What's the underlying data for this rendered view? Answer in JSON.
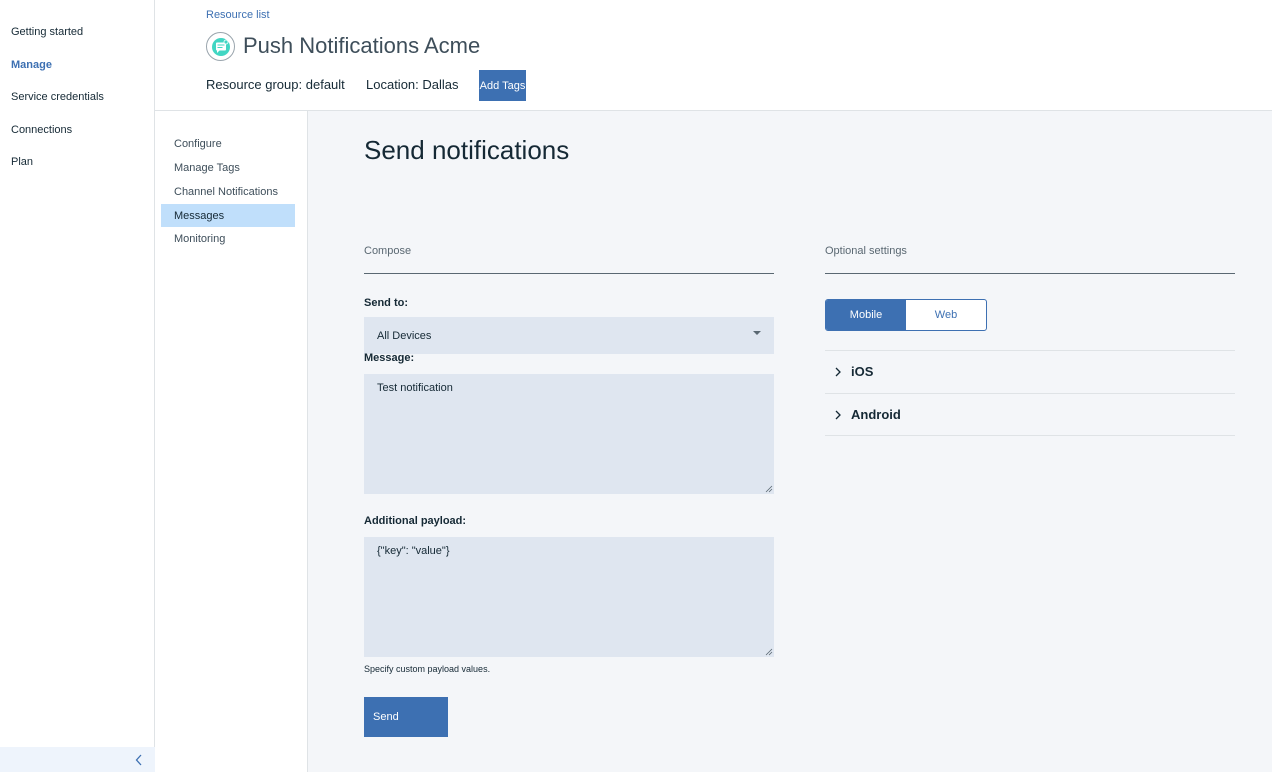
{
  "leftnav": {
    "items": [
      {
        "label": "Getting started"
      },
      {
        "label": "Manage"
      },
      {
        "label": "Service credentials"
      },
      {
        "label": "Connections"
      },
      {
        "label": "Plan"
      }
    ],
    "active": "Manage"
  },
  "header": {
    "breadcrumb": "Resource list",
    "title": "Push Notifications Acme",
    "resource_group_label": "Resource group:",
    "resource_group_value": "default",
    "location_label": "Location:",
    "location_value": "Dallas",
    "add_tags": "Add Tags"
  },
  "subnav": {
    "items": [
      {
        "label": "Configure"
      },
      {
        "label": "Manage Tags"
      },
      {
        "label": "Channel Notifications"
      },
      {
        "label": "Messages"
      },
      {
        "label": "Monitoring"
      }
    ],
    "active": "Messages"
  },
  "main": {
    "heading": "Send notifications",
    "compose_label": "Compose",
    "optional_label": "Optional settings",
    "send_to_label": "Send to:",
    "send_to_value": "All Devices",
    "message_label": "Message:",
    "message_value": "Test notification",
    "payload_label": "Additional payload:",
    "payload_value": "{\"key\": \"value\"}",
    "payload_helper": "Specify custom payload values.",
    "send_button": "Send",
    "platform_toggle": {
      "options": [
        "Mobile",
        "Web"
      ],
      "selected": "Mobile"
    },
    "accordions": [
      {
        "label": "iOS"
      },
      {
        "label": "Android"
      }
    ]
  },
  "colors": {
    "accent": "#3d70b2",
    "selected_nav": "#c0dffb",
    "field_bg": "#dfe6f0",
    "page_bg": "#f4f6f9"
  }
}
